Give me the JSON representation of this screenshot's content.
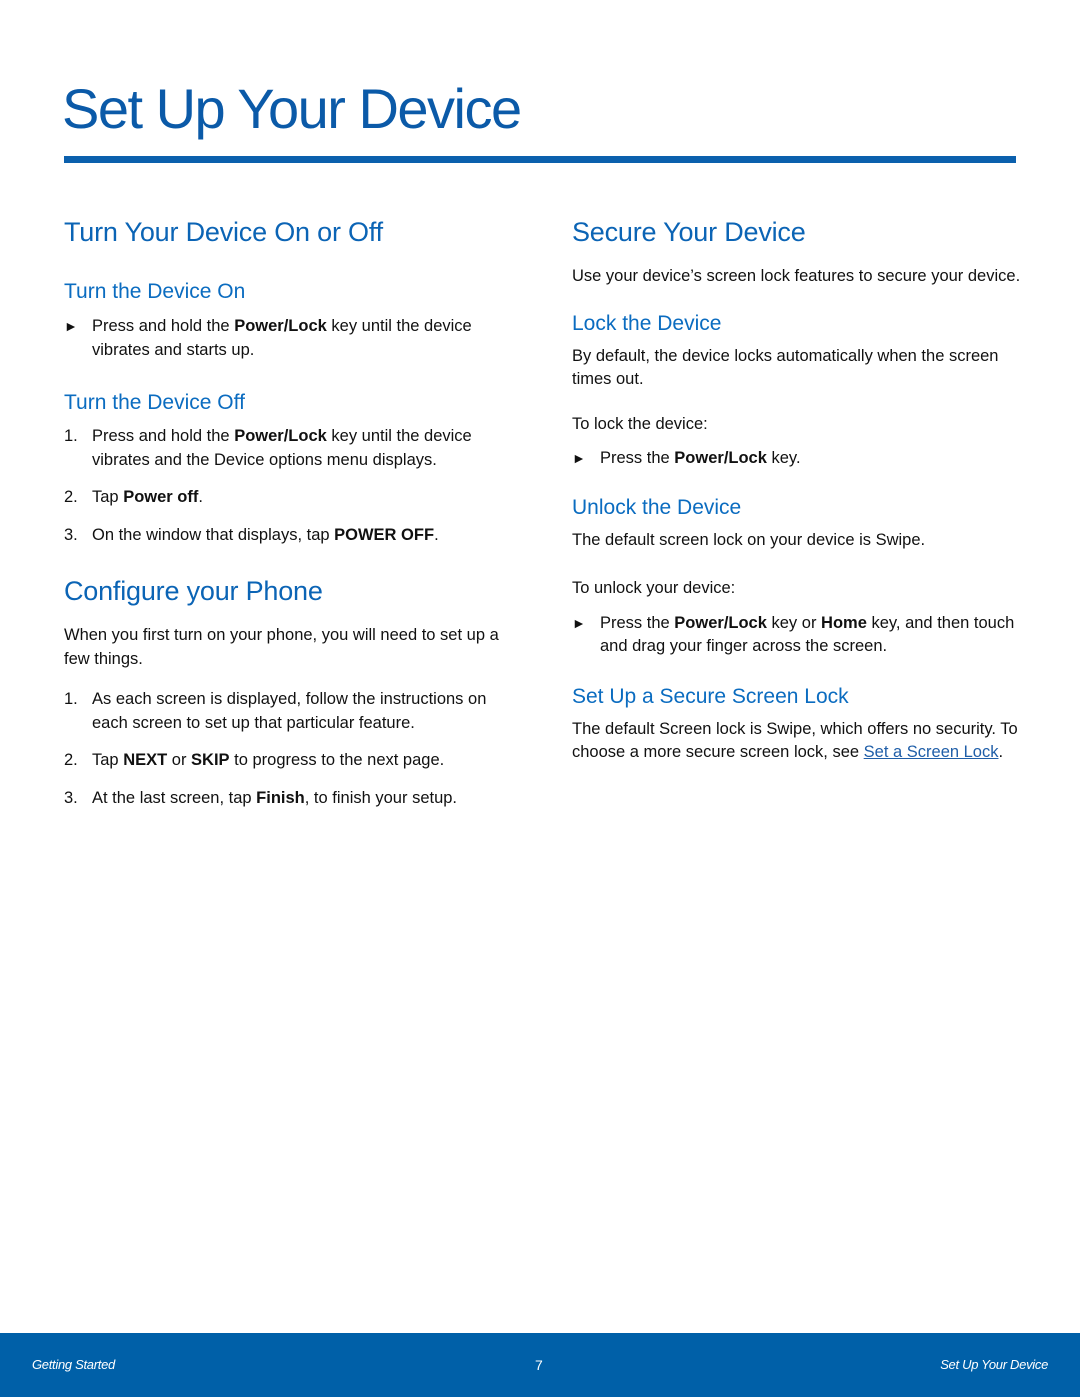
{
  "page": {
    "title": "Set Up Your Device",
    "accent_color": "#0b60ad"
  },
  "left": {
    "section1": {
      "heading": "Turn Your Device On or Off",
      "on": {
        "heading": "Turn the Device On",
        "step": {
          "pre": "Press and hold the ",
          "bold": "Power/Lock",
          "post": " key until the device vibrates and starts up."
        }
      },
      "off": {
        "heading": "Turn the Device Off",
        "steps": [
          {
            "num": "1.",
            "pre": "Press and hold the ",
            "bold": "Power/Lock",
            "post": " key until the device vibrates and the Device options menu displays."
          },
          {
            "num": "2.",
            "pre": "Tap ",
            "bold": "Power off",
            "post": "."
          },
          {
            "num": "3.",
            "pre": "On the window that displays, tap ",
            "bold": "POWER OFF",
            "post": "."
          }
        ]
      }
    },
    "section2": {
      "heading": "Configure your Phone",
      "intro": "When you first turn on your phone, you will need to set up a few things.",
      "steps": [
        {
          "num": "1.",
          "text": "As each screen is displayed, follow the instructions on each screen to set up that particular feature."
        },
        {
          "num": "2.",
          "pre": "Tap ",
          "bold1": "NEXT",
          "mid": " or ",
          "bold2": "SKIP",
          "post": " to progress to the next page."
        },
        {
          "num": "3.",
          "pre": "At the last screen, tap ",
          "bold": "Finish",
          "post": ", to finish your setup."
        }
      ]
    }
  },
  "right": {
    "heading": "Secure Your Device",
    "intro": "Use your device’s screen lock features to secure your device.",
    "lock": {
      "heading": "Lock the Device",
      "desc": "By default, the device locks automatically when the screen times out.",
      "lead": "To lock the device:",
      "step": {
        "pre": "Press the ",
        "bold": "Power/Lock",
        "post": " key."
      }
    },
    "unlock": {
      "heading": "Unlock the Device",
      "desc": "The default screen lock on your device is Swipe.",
      "lead": "To unlock your device:",
      "step": {
        "pre": "Press the ",
        "bold1": "Power/Lock",
        "mid": " key or ",
        "bold2": "Home",
        "post": " key, and then touch and drag your finger across the screen."
      }
    },
    "secure": {
      "heading": "Set Up a Secure Screen Lock",
      "desc": "The default Screen lock is Swipe, which offers no security. To choose a more secure screen lock, see ",
      "link": "Set a Screen Lock",
      "post": "."
    }
  },
  "markers": {
    "arrow": "►"
  },
  "footer": {
    "left": "Getting Started",
    "page_number": "7",
    "right": "Set Up Your Device",
    "color": "#0060a8"
  }
}
